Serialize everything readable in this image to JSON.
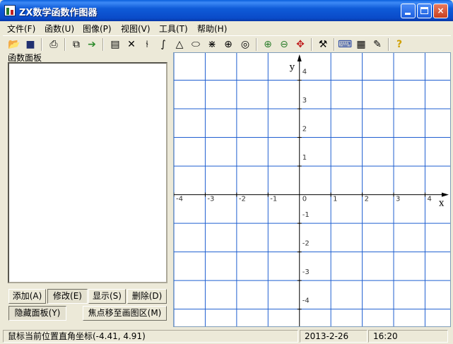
{
  "window": {
    "title": "ZX数学函数作图器",
    "minimize_label": "",
    "maximize_label": "",
    "close_label": "×"
  },
  "menu": [
    "文件(F)",
    "函数(U)",
    "图像(P)",
    "视图(V)",
    "工具(T)",
    "帮助(H)"
  ],
  "toolbar": {
    "icons": [
      "open-icon",
      "save-icon",
      "print-icon",
      "copy-icon",
      "export-icon",
      "calculator-icon",
      "delete-icon",
      "derivative-icon",
      "integral-icon",
      "triangle-icon",
      "ellipse-icon",
      "hyperbola-icon",
      "parabola-icon",
      "polar-icon",
      "zoom-in-icon",
      "zoom-out-icon",
      "move-icon",
      "tools-icon",
      "keyboard-icon",
      "table-icon",
      "settings-icon",
      "help-icon"
    ]
  },
  "panel": {
    "title": "函数面板",
    "buttons": {
      "add": "添加(A)",
      "modify": "修改(E)",
      "show": "显示(S)",
      "delete": "删除(D)",
      "hide": "隐藏面板(Y)",
      "focus": "焦点移至画图区(M)"
    }
  },
  "graph": {
    "x_axis_label": "x",
    "y_axis_label": "y",
    "x_range": [
      -4.0,
      4.8
    ],
    "y_range": [
      -4.6,
      4.95
    ],
    "x_ticks": [
      -4,
      -3,
      -2,
      -1,
      1,
      2,
      3,
      4
    ],
    "y_ticks": [
      4,
      3,
      2,
      1,
      -1,
      -2,
      -3,
      -4
    ],
    "origin_label": "0",
    "grid_color": "#1f5fd0",
    "axis_color": "#000000"
  },
  "status": {
    "coords": "鼠标当前位置直角坐标(-4.41, 4.91)",
    "date": "2013-2-26",
    "time": "16:20"
  },
  "colors": {
    "titlebar": "#0a4bc9",
    "face": "#ece9d8"
  }
}
